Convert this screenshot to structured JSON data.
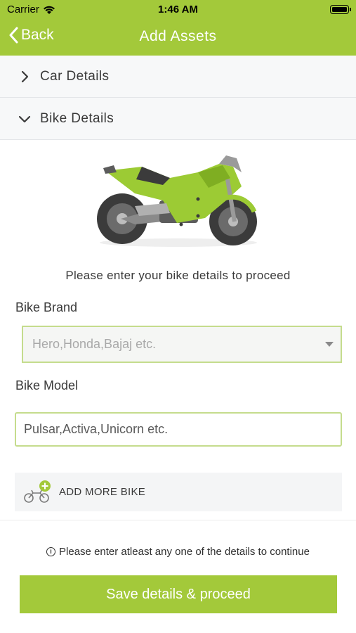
{
  "status_bar": {
    "carrier": "Carrier",
    "time": "1:46 AM"
  },
  "nav": {
    "back_label": "Back",
    "title": "Add Assets"
  },
  "accordion": {
    "car": {
      "label": "Car Details",
      "expanded": false
    },
    "bike": {
      "label": "Bike Details",
      "expanded": true
    }
  },
  "bike_form": {
    "prompt": "Please enter your bike details to proceed",
    "brand_label": "Bike Brand",
    "brand_placeholder": "Hero,Honda,Bajaj etc.",
    "model_label": "Bike Model",
    "model_placeholder": "Pulsar,Activa,Unicorn etc.",
    "add_more_label": "ADD MORE BIKE"
  },
  "footer": {
    "notice": "Please enter atleast any one of the details to continue",
    "save_label": "Save details & proceed"
  },
  "colors": {
    "accent": "#a3c93a",
    "field_border": "#c5dc8d",
    "row_bg": "#f7f8f9"
  },
  "icons": [
    "wifi-icon",
    "battery-icon",
    "back-chevron-icon",
    "chevron-right-icon",
    "chevron-down-icon",
    "motorcycle-illustration",
    "dropdown-caret-icon",
    "add-bike-icon",
    "info-icon"
  ]
}
